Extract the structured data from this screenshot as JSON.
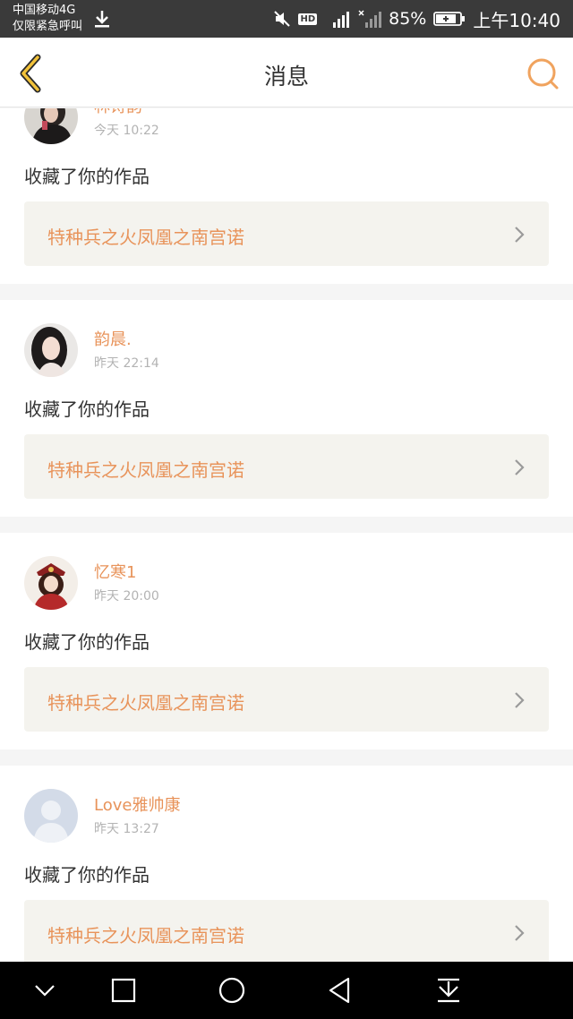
{
  "status_bar": {
    "carrier": "中国移动4G",
    "emergency": "仅限紧急呼叫",
    "battery_percent": "85%",
    "time": "上午10:40",
    "hd_badge": "HD",
    "network_label": "4G",
    "icons": [
      "download-icon",
      "mute-icon",
      "signal-icon",
      "signal-noservice-icon",
      "battery-icon"
    ]
  },
  "header": {
    "title": "消息",
    "back_icon": "chevron-left-icon",
    "search_icon": "search-icon",
    "accent_color": "#e8935a"
  },
  "messages": [
    {
      "username": "林诗韵",
      "time": "今天 10:22",
      "action": "收藏了你的作品",
      "work_title": "特种兵之火凤凰之南宫诺"
    },
    {
      "username": "韵晨.",
      "time": "昨天 22:14",
      "action": "收藏了你的作品",
      "work_title": "特种兵之火凤凰之南宫诺"
    },
    {
      "username": "忆寒1",
      "time": "昨天 20:00",
      "action": "收藏了你的作品",
      "work_title": "特种兵之火凤凰之南宫诺"
    },
    {
      "username": "Love雅帅康",
      "time": "昨天 13:27",
      "action": "收藏了你的作品",
      "work_title": "特种兵之火凤凰之南宫诺"
    }
  ],
  "nav_bar": {
    "icons": [
      "chevron-down-icon",
      "recent-apps-icon",
      "home-icon",
      "back-icon",
      "notification-pull-icon"
    ]
  }
}
